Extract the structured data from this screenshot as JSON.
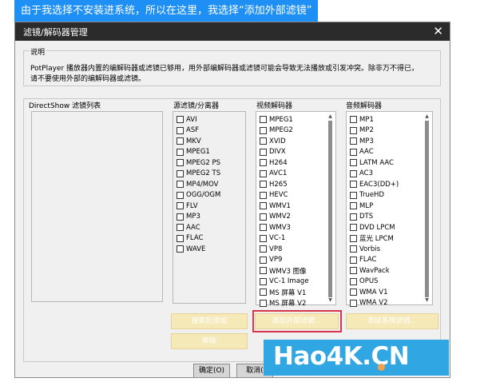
{
  "banner": {
    "text": "由于我选择不安装进系统，所以在这里，我选择“添加外部滤镜”"
  },
  "dialog": {
    "title": "滤镜/解码器管理",
    "close_glyph": "✕",
    "description": {
      "legend": "说明",
      "text": "PotPlayer 播放器内置的编解码器或滤镜已够用，用外部编解码器或滤镜可能会导致无法播放或引发冲突。除非万不得已，请不要使用外部的编解码器或滤镜。"
    },
    "directshow": {
      "title": "DirectShow 滤镜列表"
    },
    "source_splitter": {
      "title": "源滤镜/分离器",
      "items": [
        "AVI",
        "ASF",
        "MKV",
        "MPEG1",
        "MPEG2 PS",
        "MPEG2 TS",
        "MP4/MOV",
        "OGG/OGM",
        "FLV",
        "MP3",
        "AAC",
        "FLAC",
        "WAVE"
      ]
    },
    "video_decoder": {
      "title": "视频解码器",
      "items": [
        "MPEG1",
        "MPEG2",
        "XVID",
        "DIVX",
        "H264",
        "AVC1",
        "H265",
        "HEVC",
        "WMV1",
        "WMV2",
        "WMV3",
        "VC-1",
        "VP8",
        "VP9",
        "WMV3 图像",
        "VC-1 Image",
        "MS 屏幕 V1",
        "MS 屏幕 V2"
      ]
    },
    "audio_decoder": {
      "title": "音频解码器",
      "items": [
        "MP1",
        "MP2",
        "MP3",
        "AAC",
        "LATM AAC",
        "AC3",
        "EAC3(DD+)",
        "TrueHD",
        "MLP",
        "DTS",
        "DVD LPCM",
        "蓝光 LPCM",
        "Vorbis",
        "FLAC",
        "WavPack",
        "OPUS",
        "WMA V1",
        "WMA V2"
      ]
    },
    "buttons": {
      "search_add": "搜索后添加",
      "add_external": "添加外部滤镜...",
      "add_system": "添加系统滤镜...",
      "remove": "移除",
      "ok": "确定(O)",
      "cancel": "取消("
    }
  },
  "watermark": {
    "text": "Hao4K.CN"
  },
  "colors": {
    "banner_bg": "#1e8ff5",
    "titlebar_bg": "#2b2b2b",
    "dialog_bg": "#f0f0f0",
    "yellow_button": "#f6e9b8",
    "highlight_border": "#d8344a",
    "watermark_bg": "#30a6e2",
    "watermark_dot": "#f5a04a"
  }
}
